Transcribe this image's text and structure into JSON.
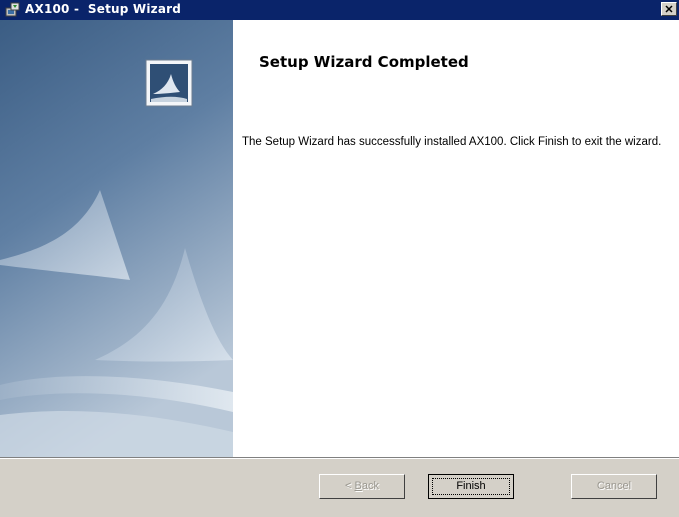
{
  "window": {
    "title": "AX100 -  Setup Wizard",
    "close_glyph": "✕"
  },
  "content": {
    "title": "Setup Wizard Completed",
    "body": "The Setup Wizard has successfully installed AX100. Click Finish to exit the wizard."
  },
  "buttons": {
    "back": {
      "prefix": "< ",
      "mnemonic": "B",
      "rest": "ack",
      "enabled": false
    },
    "finish": {
      "label": "Finish",
      "enabled": true,
      "default": true
    },
    "cancel": {
      "label": "Cancel",
      "enabled": false
    }
  },
  "colors": {
    "titlebar": "#0a246a",
    "dialog_face": "#d4d0c8",
    "banner_top": "#3d5f86",
    "banner_bottom": "#c9d6e2"
  },
  "icons": {
    "app": "installer-icon",
    "banner": "sail-logo-icon"
  }
}
